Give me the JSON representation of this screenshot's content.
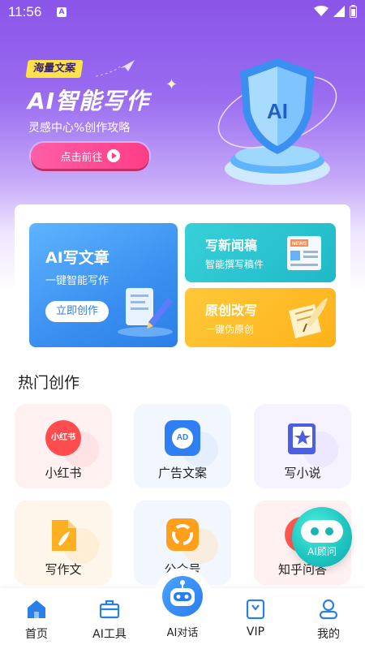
{
  "status_bar": {
    "time": "11:56",
    "app_indicator": "A"
  },
  "banner": {
    "tag": "海量文案",
    "headline": "AI智能写作",
    "subline": "灵感中心%创作攻略",
    "cta_label": "点击前往",
    "shield_text": "AI"
  },
  "cards": {
    "ai_article": {
      "title": "AI写文章",
      "subtitle": "一键智能写作",
      "button": "立即创作"
    },
    "news": {
      "title": "写新闻稿",
      "subtitle": "智能撰写稿件",
      "badge": "NEWS"
    },
    "rewrite": {
      "title": "原创改写",
      "subtitle": "一键伪原创"
    }
  },
  "hot": {
    "title": "热门创作",
    "items": [
      {
        "label": "小红书",
        "icon": "xiaohongshu-icon",
        "icon_text": "小红书"
      },
      {
        "label": "广告文案",
        "icon": "ad-icon",
        "icon_text": "AD"
      },
      {
        "label": "写小说",
        "icon": "novel-icon"
      },
      {
        "label": "写作文",
        "icon": "essay-icon"
      },
      {
        "label": "公众号",
        "icon": "official-account-icon"
      },
      {
        "label": "知乎问答",
        "icon": "zhihu-icon",
        "icon_text": "知"
      }
    ]
  },
  "fab": {
    "label": "AI顾问"
  },
  "nav": {
    "items": [
      {
        "label": "首页",
        "icon": "home-icon",
        "active": true
      },
      {
        "label": "AI工具",
        "icon": "toolbox-icon"
      },
      {
        "label": "AI对话",
        "icon": "robot-icon"
      },
      {
        "label": "VIP",
        "icon": "vip-icon"
      },
      {
        "label": "我的",
        "icon": "profile-icon"
      }
    ]
  },
  "colors": {
    "primary": "#2b7fe8",
    "banner": "#8a55e8",
    "cta": "#ff3d86",
    "accent_teal": "#1fc7c0"
  }
}
